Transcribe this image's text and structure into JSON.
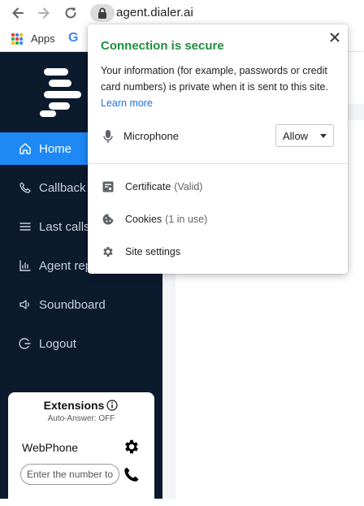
{
  "browser": {
    "url": "agent.dialer.ai",
    "bookmarks": {
      "apps_label": "Apps",
      "google_label": "G"
    }
  },
  "sidebar": {
    "items": [
      {
        "label": "Home",
        "icon": "home-icon",
        "active": true
      },
      {
        "label": "Callback",
        "icon": "phone-outline-icon"
      },
      {
        "label": "Last calls",
        "icon": "list-icon"
      },
      {
        "label": "Agent rep",
        "icon": "bar-chart-icon"
      },
      {
        "label": "Soundboard",
        "icon": "speaker-icon"
      },
      {
        "label": "Logout",
        "icon": "logout-icon"
      }
    ],
    "accent_color": "#1e88f5",
    "background_color": "#0c1a2e"
  },
  "extensions": {
    "title": "Extensions",
    "subtitle": "Auto-Answer: OFF",
    "webphone_label": "WebPhone",
    "dial_placeholder": "Enter the number to"
  },
  "popup": {
    "title": "Connection is secure",
    "title_color": "#1e8e3e",
    "description": "Your information (for example, passwords or credit card numbers) is private when it is sent to this site.",
    "learn_more": "Learn more",
    "permission": {
      "label": "Microphone",
      "value": "Allow"
    },
    "rows": [
      {
        "label": "Certificate",
        "detail": "(Valid)",
        "icon": "certificate-icon"
      },
      {
        "label": "Cookies",
        "detail": "(1 in use)",
        "icon": "cookie-icon"
      },
      {
        "label": "Site settings",
        "detail": "",
        "icon": "gear-icon"
      }
    ]
  }
}
